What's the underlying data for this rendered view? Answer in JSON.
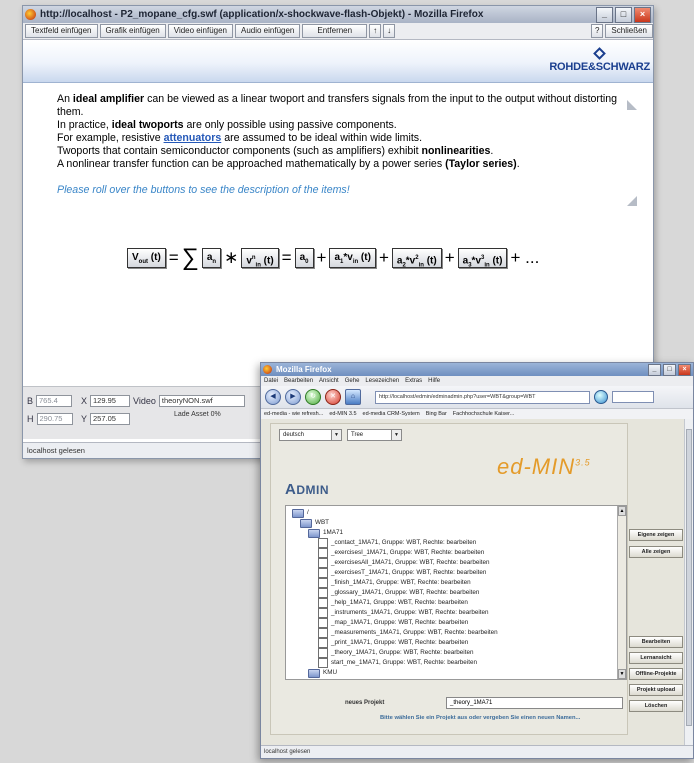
{
  "window1": {
    "title": "http://localhost - P2_mopane_cfg.swf (application/x-shockwave-flash-Objekt) - Mozilla Firefox",
    "controls": {
      "minimize": "_",
      "maximize": "□",
      "close": "×"
    },
    "toolbar": {
      "textfield": "Textfeld einfügen",
      "graphic": "Grafik einfügen",
      "video": "Video einfügen",
      "audio": "Audio einfügen",
      "remove": "Entfernen",
      "up": "↑",
      "down": "↓",
      "help": "?",
      "close": "Schließen"
    },
    "logo": "ROHDE&SCHWARZ",
    "content": {
      "p1_a": "An ",
      "p1_b": "ideal amplifier",
      "p1_c": " can be viewed as a linear twoport and transfers signals from the input to the output without distorting them.",
      "p2_a": "In practice, ",
      "p2_b": "ideal twoports",
      "p2_c": " are only possible using passive components.",
      "p3_a": "For example, resistive ",
      "p3_link": "attenuators",
      "p3_c": " are assumed to be ideal within wide limits.",
      "p4_a": "Twoports that contain semiconductor components (such as amplifiers) exhibit ",
      "p4_b": "nonlinearities",
      "p4_c": ".",
      "p5_a": "A nonlinear transfer function can be approached mathematically by a power series ",
      "p5_b": "(Taylor series)",
      "p5_c": ".",
      "hint": "Please roll over the buttons to see the description of the items!"
    },
    "formula": {
      "vout": "V",
      "vout_sub": "out",
      "vout_t": " (t)",
      "eq": "=",
      "sum": "∑",
      "an": "a",
      "an_sub": "n",
      "times": "∗",
      "vin": "v",
      "vin_sup": "n",
      "vin_sub": "in",
      "vin_t": " (t)",
      "eq2": "=",
      "a0": "a",
      "a0_sub": "0",
      "plus1": "+",
      "t1": "a",
      "t1_sub": "1",
      "t1_b": "*v",
      "t1_in": "in",
      "t1_t": " (t)",
      "plus2": "+",
      "t2": "a",
      "t2_sub": "2",
      "t2_b": "*v",
      "t2_sup": "2",
      "t2_in": "in",
      "t2_t": " (t)",
      "plus3": "+",
      "t3": "a",
      "t3_sub": "3",
      "t3_b": "*v",
      "t3_sup": "3",
      "t3_in": "in",
      "t3_t": " (t)",
      "tail": "+ ..."
    },
    "props": {
      "b_label": "B",
      "b_value": "765.4",
      "h_label": "H",
      "h_value": "290.75",
      "x_label": "X",
      "x_value": "129.95",
      "y_label": "Y",
      "y_value": "257.05",
      "video_label": "Video",
      "video_file": "theoryNON.swf",
      "loading": "Lade Asset 0%"
    },
    "status": "localhost gelesen"
  },
  "window2": {
    "title": "Mozilla Firefox",
    "menu": [
      "Datei",
      "Bearbeiten",
      "Ansicht",
      "Gehe",
      "Lesezeichen",
      "Extras",
      "Hilfe"
    ],
    "nav_labels": {
      "back": "Zurück",
      "forward": "Vor",
      "reload": "Neu laden",
      "stop": "Stopp",
      "home": "Startseite"
    },
    "url": "http://localhost/edmin/edminadmin.php?user=WBT&group=WBT",
    "bookmarks": [
      "ed-media - wie refresh...",
      "ed-MIN 3.5",
      "ed-media CRM-System",
      "Bing Bar",
      "Fachhochschule Kaiser..."
    ],
    "lang_select": "deutsch",
    "view_select": "Tree",
    "admin_title_a": "A",
    "admin_title_b": "DMIN",
    "logo_main": "ed-MIN",
    "logo_version": "3.5",
    "tree": {
      "root": "/",
      "wbt": "WBT",
      "course": "1MA71",
      "items": [
        "_contact_1MA71, Gruppe: WBT, Rechte: bearbeiten",
        "_exercisesI_1MA71, Gruppe: WBT, Rechte: bearbeiten",
        "_exercisesAll_1MA71, Gruppe: WBT, Rechte: bearbeiten",
        "_exercisesT_1MA71, Gruppe: WBT, Rechte: bearbeiten",
        "_finish_1MA71, Gruppe: WBT, Rechte: bearbeiten",
        "_glossary_1MA71, Gruppe: WBT, Rechte: bearbeiten",
        "_help_1MA71, Gruppe: WBT, Rechte: bearbeiten",
        "_instruments_1MA71, Gruppe: WBT, Rechte: bearbeiten",
        "_map_1MA71, Gruppe: WBT, Rechte: bearbeiten",
        "_measurements_1MA71, Gruppe: WBT, Rechte: bearbeiten",
        "_print_1MA71, Gruppe: WBT, Rechte: bearbeiten",
        "_theory_1MA71, Gruppe: WBT, Rechte: bearbeiten",
        "start_me_1MA71, Gruppe: WBT, Rechte: bearbeiten"
      ],
      "kmu": "KMU"
    },
    "new_project_label": "neues Projekt",
    "new_project_value": "_theory_1MA71",
    "hint": "Bitte wählen Sie ein Projekt aus oder vergeben Sie einen neuen Namen...",
    "buttons": {
      "own": "Eigene zeigen",
      "all": "Alle zeigen",
      "edit": "Bearbeiten",
      "learner": "Lernansicht",
      "offline": "Offline-Projekte",
      "upload": "Projekt upload",
      "delete": "Löschen"
    },
    "status": "localhost gelesen"
  }
}
